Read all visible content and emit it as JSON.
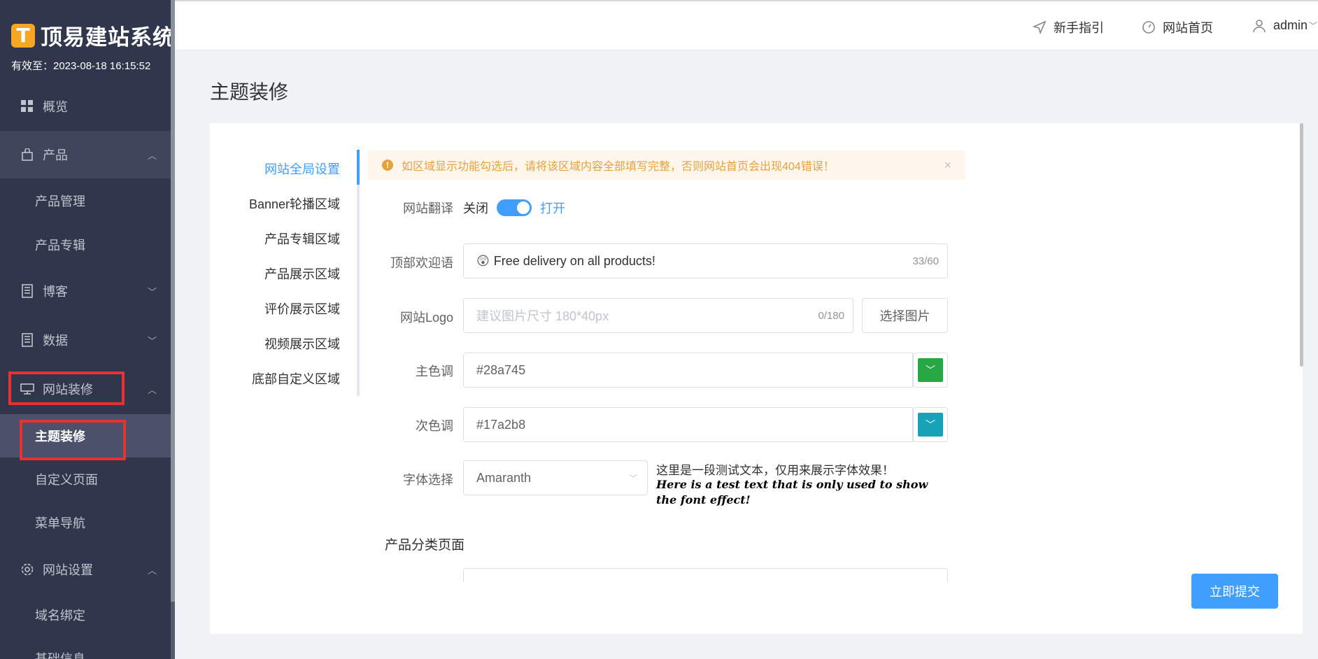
{
  "brand": {
    "logo_glyph": "T",
    "name": "顶易建站系统",
    "expire": "有效至：2023-08-18 16:15:52",
    "logo_color": "#f5a623"
  },
  "sidebar": {
    "items": [
      {
        "label": "概览",
        "icon": "grid-icon"
      },
      {
        "label": "产品",
        "icon": "bag-icon",
        "expanded": true
      },
      {
        "label": "产品管理"
      },
      {
        "label": "产品专辑"
      },
      {
        "label": "博客",
        "icon": "book-icon",
        "expanded": false
      },
      {
        "label": "数据",
        "icon": "book-icon",
        "expanded": false
      },
      {
        "label": "网站装修",
        "icon": "monitor-icon",
        "expanded": true
      },
      {
        "label": "主题装修",
        "active": true
      },
      {
        "label": "自定义页面"
      },
      {
        "label": "菜单导航"
      },
      {
        "label": "网站设置",
        "icon": "gear-icon",
        "expanded": true
      },
      {
        "label": "域名绑定"
      },
      {
        "label": "基础信息"
      }
    ]
  },
  "header": {
    "guide": "新手指引",
    "homepage": "网站首页",
    "user": "admin"
  },
  "page": {
    "title": "主题装修"
  },
  "tabs": [
    {
      "label": "网站全局设置",
      "active": true
    },
    {
      "label": "Banner轮播区域"
    },
    {
      "label": "产品专辑区域"
    },
    {
      "label": "产品展示区域"
    },
    {
      "label": "评价展示区域"
    },
    {
      "label": "视频展示区域"
    },
    {
      "label": "底部自定义区域"
    }
  ],
  "alert": {
    "text": "如区域显示功能勾选后，请将该区域内容全部填写完整，否则网站首页会出现404错误！",
    "close": "×"
  },
  "form": {
    "translate": {
      "label": "网站翻译",
      "off": "关闭",
      "on": "打开",
      "value": true
    },
    "welcome": {
      "label": "顶部欢迎语",
      "emoji": "😲",
      "value": "Free delivery on all products!",
      "counter": "33/60"
    },
    "logo": {
      "label": "网站Logo",
      "placeholder": "建议图片尺寸 180*40px",
      "counter": "0/180",
      "button": "选择图片"
    },
    "primary_color": {
      "label": "主色调",
      "value": "#28a745"
    },
    "secondary_color": {
      "label": "次色调",
      "value": "#17a2b8"
    },
    "font": {
      "label": "字体选择",
      "value": "Amaranth",
      "sample_cn": "这里是一段测试文本，仅用来展示字体效果！",
      "sample_en": "Here is a test text that is only used to show the font effect!"
    }
  },
  "section": {
    "title": "产品分类页面"
  },
  "submit": "立即提交",
  "colors": {
    "sidebar_bg": "#30374d",
    "accent": "#409eff",
    "highlight_box": "#e63232",
    "alert_text": "#e6a23c"
  }
}
